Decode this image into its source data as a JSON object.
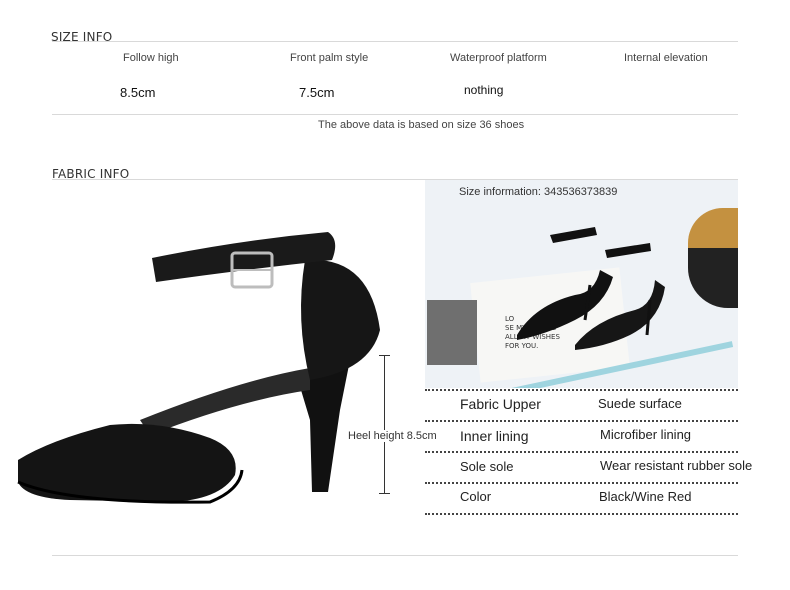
{
  "size_info": {
    "title": "SIZE INFO",
    "columns": [
      {
        "label": "Follow high",
        "value": "8.5cm"
      },
      {
        "label": "Front palm style",
        "value": "7.5cm"
      },
      {
        "label": "Waterproof platform",
        "value": "nothing"
      },
      {
        "label": "Internal elevation",
        "value": ""
      }
    ],
    "note": "The above data is based on size 36 shoes"
  },
  "fabric_info": {
    "title": "FABRIC INFO",
    "heel_label": "Heel height 8.5cm",
    "photo_caption": "Size information: 343536373839",
    "photo_text": "LO\nSE MY WISHES\nALL MY WISHES\nFOR YOU.",
    "rows": [
      {
        "label": "Fabric Upper",
        "value": "Suede surface"
      },
      {
        "label": "Inner lining",
        "value": "Microfiber lining"
      },
      {
        "label": "Sole sole",
        "value": "Wear resistant rubber sole"
      },
      {
        "label": "Color",
        "value": "Black/Wine Red"
      }
    ]
  }
}
